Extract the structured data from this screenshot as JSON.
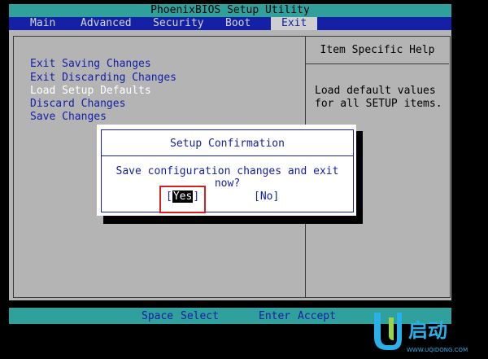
{
  "title": "PhoenixBIOS Setup Utility",
  "menu": {
    "items": [
      {
        "label": "Main"
      },
      {
        "label": "Advanced"
      },
      {
        "label": "Security"
      },
      {
        "label": "Boot"
      },
      {
        "label": "Exit"
      }
    ],
    "active": "Exit"
  },
  "exit_menu": {
    "items": [
      {
        "label": "Exit Saving Changes"
      },
      {
        "label": "Exit Discarding Changes"
      },
      {
        "label": "Load Setup Defaults"
      },
      {
        "label": "Discard Changes"
      },
      {
        "label": "Save Changes"
      }
    ],
    "selected": "Load Setup Defaults"
  },
  "help": {
    "title": "Item Specific Help",
    "lines": [
      "Load default values",
      "for all SETUP items."
    ]
  },
  "dialog": {
    "title": "Setup Confirmation",
    "message": "Save configuration changes and exit now?",
    "yes_open": "[",
    "yes_label": "Yes",
    "yes_close": "]",
    "no_label": "[No]"
  },
  "footer": {
    "key1": "Space",
    "desc1": "Select",
    "key2": "Enter",
    "desc2": "Accept"
  },
  "colors": {
    "teal": "#2fa09c",
    "bios_blue": "#1420a6",
    "panel_gray": "#b4b4b4",
    "highlight_red": "#d61f1f",
    "logo_blue": "#2ab0e8"
  },
  "watermark": {
    "cn_text": "启动",
    "url": "WWW.UQIDONG.COM"
  }
}
